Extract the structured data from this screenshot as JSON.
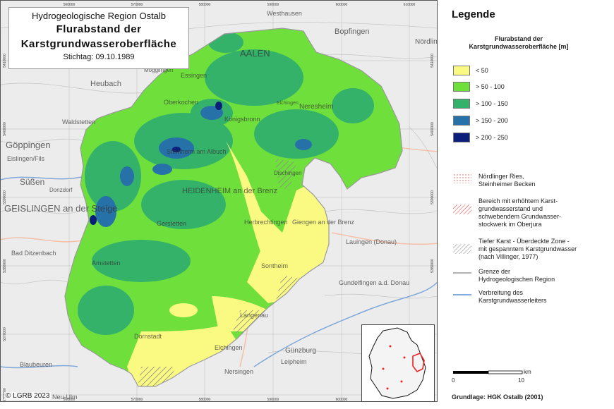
{
  "title": {
    "region": "Hydrogeologische Region Ostalb",
    "main_line1": "Flurabstand der",
    "main_line2": "Karstgrundwasseroberfläche",
    "date": "Stichtag: 09.10.1989"
  },
  "frame_ticks": {
    "x": [
      "560000",
      "570000",
      "580000",
      "590000",
      "600000",
      "610000"
    ],
    "y": [
      "5410000",
      "5400000",
      "5390000",
      "5380000",
      "5370000",
      "5360000"
    ]
  },
  "place_labels": [
    "Westhausen",
    "Bopfingen",
    "Nördlingen",
    "Heubach",
    "Mögglingen",
    "Essingen",
    "AALEN",
    "Oberkochen",
    "Elchingen",
    "Neresheim",
    "Königsbronn",
    "Waldstetten",
    "Göppingen",
    "Steinheim am Albuch",
    "Dischingen",
    "Eislingen/Fils",
    "Süßen",
    "HEIDENHEIM an der Brenz",
    "Donzdorf",
    "GEISLINGEN an der Steige",
    "Gerstetten",
    "Herbrechtingen",
    "Giengen an der Brenz",
    "Bad Ditzenbach",
    "Lauingen (Donau)",
    "Sontheim",
    "Gundelfingen a.d. Donau",
    "Amstetten",
    "Langenau",
    "Dornstadt",
    "Günzburg",
    "Elchingen",
    "Blaubeuren",
    "Leipheim",
    "Nersingen",
    "Neu-Ulm"
  ],
  "copyright": "© LGRB 2023",
  "legend": {
    "heading": "Legende",
    "subtitle_line1": "Flurabstand der",
    "subtitle_line2": "Karstgrundwasseroberfläche [m]",
    "classes": [
      {
        "label": "< 50",
        "color": "#fafa82"
      },
      {
        "label": "> 50 - 100",
        "color": "#6fe03b"
      },
      {
        "label": "> 100 - 150",
        "color": "#35b26a"
      },
      {
        "label": "> 150 - 200",
        "color": "#2672a8"
      },
      {
        "label": "> 200 - 250",
        "color": "#0b1f7a"
      }
    ],
    "pattern_items": [
      {
        "lines": [
          "Nördlinger Ries,",
          "Steinheimer Becken"
        ]
      },
      {
        "lines": [
          "Bereich mit erhöhtem Karst-",
          "grundwasserstand und",
          "schwebendem Grundwasser-",
          "stockwerk im Oberjura"
        ]
      },
      {
        "lines": [
          "Tiefer Karst - Überdeckte Zone -",
          "mit gespanntem Karstgrundwasser",
          "(nach Villinger, 1977)"
        ]
      },
      {
        "lines": [
          "Grenze der",
          "Hydrogeologischen Region"
        ]
      },
      {
        "lines": [
          "Verbreitung des",
          "Karstgrundwasserleiters"
        ]
      }
    ],
    "scale": {
      "ticks": [
        "0",
        "10"
      ],
      "unit": "km"
    },
    "grundlage": "Grundlage: HGK Ostalb (2001)"
  }
}
